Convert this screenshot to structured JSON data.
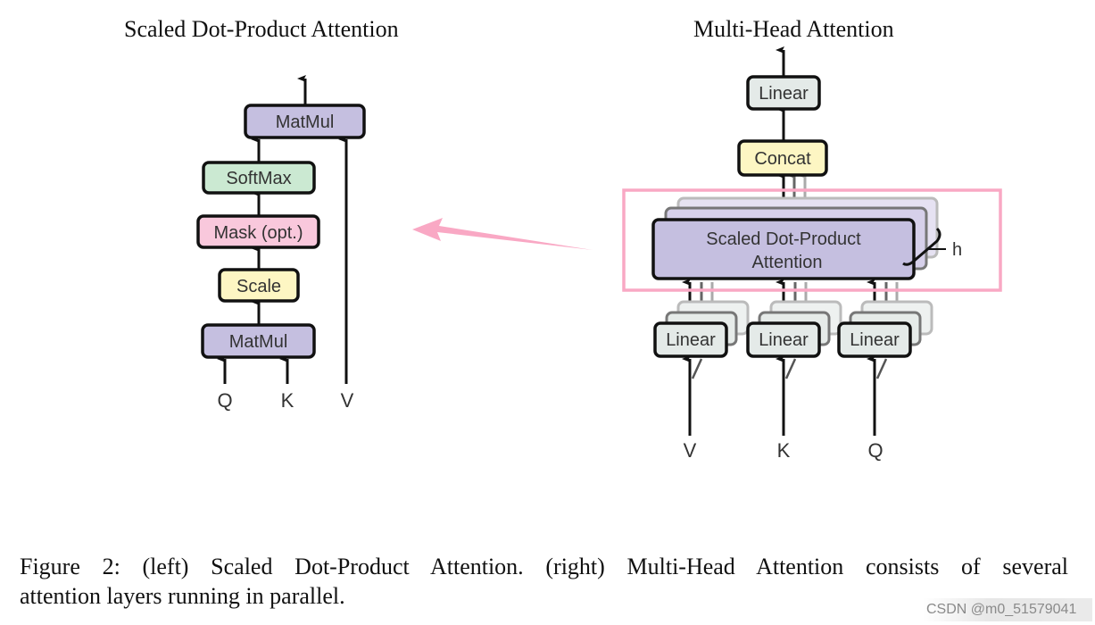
{
  "left_diagram": {
    "title": "Scaled Dot-Product Attention",
    "blocks": [
      {
        "id": "matmul-top",
        "label": "MatMul",
        "color": "#c5bfe0"
      },
      {
        "id": "softmax",
        "label": "SoftMax",
        "color": "#cbe9d2"
      },
      {
        "id": "mask",
        "label": "Mask (opt.)",
        "color": "#f9c8dc"
      },
      {
        "id": "scale",
        "label": "Scale",
        "color": "#fdf6c3"
      },
      {
        "id": "matmul-bottom",
        "label": "MatMul",
        "color": "#c5bfe0"
      }
    ],
    "inputs": [
      "Q",
      "K",
      "V"
    ]
  },
  "right_diagram": {
    "title": "Multi-Head Attention",
    "blocks": [
      {
        "id": "linear-out",
        "label": "Linear",
        "color": "#e4eae8"
      },
      {
        "id": "concat",
        "label": "Concat",
        "color": "#fdf6c3"
      },
      {
        "id": "sdpa",
        "label_line1": "Scaled Dot-Product",
        "label_line2": "Attention",
        "color": "#c5bfe0"
      }
    ],
    "linear_label": "Linear",
    "linear_color": "#e4eae8",
    "heads_label": "h",
    "inputs": [
      "V",
      "K",
      "Q"
    ]
  },
  "annotation": {
    "highlight_color": "#f9a8c4",
    "arrow_color": "#f9a8c4",
    "description": "highlight box on Scaled Dot-Product Attention with arrow pointing to left diagram"
  },
  "caption": {
    "line1": "Figure 2: (left) Scaled Dot-Product Attention. (right) Multi-Head Attention consists of several",
    "line2": "attention layers running in parallel."
  },
  "watermark": "CSDN @m0_51579041"
}
